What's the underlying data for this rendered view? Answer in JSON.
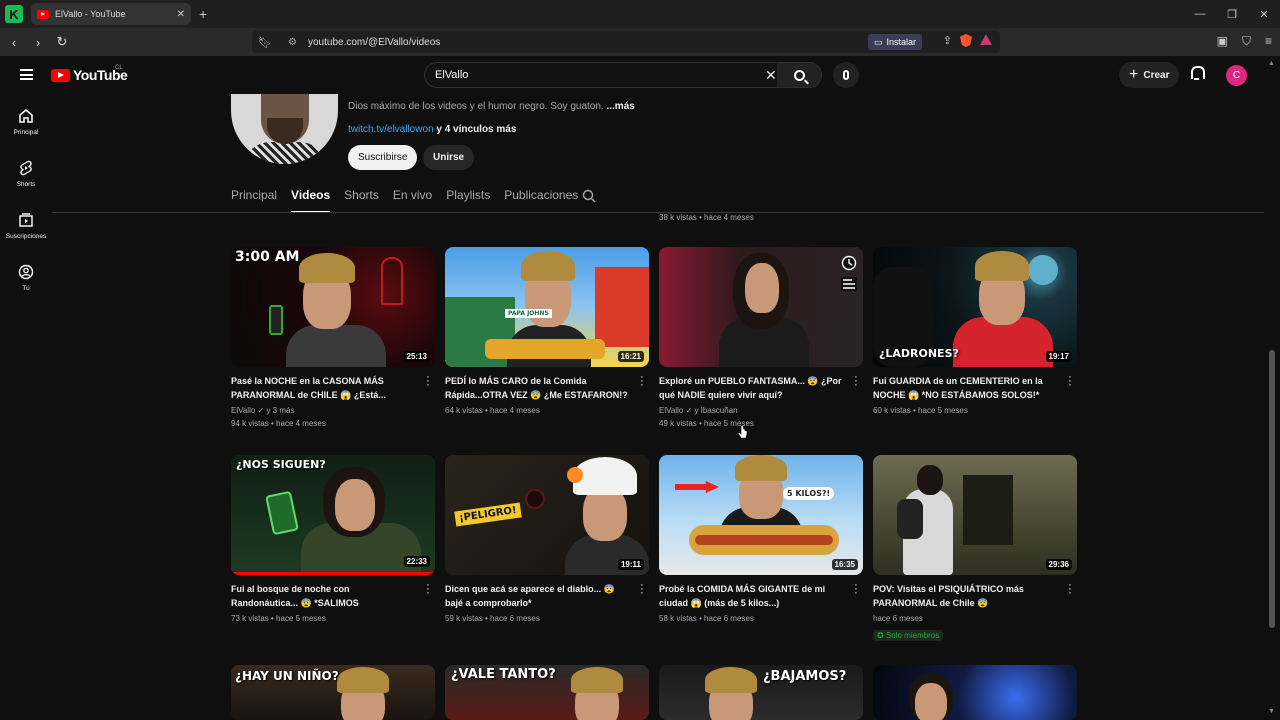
{
  "browser": {
    "tab_title": "ElVallo - YouTube",
    "url": "youtube.com/@ElVallo/videos",
    "install_label": "Instalar"
  },
  "header": {
    "logo_text": "YouTube",
    "country": "CL",
    "search_value": "ElVallo",
    "create_label": "Crear",
    "avatar_letter": "C"
  },
  "sidebar": {
    "items": [
      {
        "label": "Principal",
        "icon": "home-icon"
      },
      {
        "label": "Shorts",
        "icon": "shorts-icon"
      },
      {
        "label": "Suscripciones",
        "icon": "subscriptions-icon"
      },
      {
        "label": "Tú",
        "icon": "you-icon"
      }
    ]
  },
  "channel": {
    "description": "Dios máximo de los videos y el humor negro. Soy guaton.",
    "description_more": "...más",
    "link": "twitch.tv/elvallowon",
    "link_more": "y 4 vínculos más",
    "subscribe_label": "Suscribirse",
    "join_label": "Unirse",
    "tabs": [
      "Principal",
      "Videos",
      "Shorts",
      "En vivo",
      "Playlists",
      "Publicaciones"
    ],
    "active_tab": "Videos"
  },
  "previous_row_meta": "38 k vistas • hace 4 meses",
  "videos": [
    {
      "title": "Pasé la NOCHE en la CASONA MÁS PARANORMAL de CHILE 😱 ¿Está...",
      "author": "ElVallo ✓ y 3 más",
      "meta": "94 k vistas • hace 4 meses",
      "duration": "25:13",
      "overlay": "3:00 AM"
    },
    {
      "title": "PEDÍ lo MÁS CARO de la Comida Rápida...OTRA VEZ 😨 ¿Me ESTAFARON!?",
      "meta": "64 k vistas • hace 4 meses",
      "duration": "16:21",
      "overlay": "PAPA JOHNS"
    },
    {
      "title": "Exploré un PUEBLO FANTASMA... 😨 ¿Por qué NADIE quiere vivir aquí?",
      "author": "ElVallo ✓ y Ibascuñan",
      "meta": "49 k vistas • hace 5 meses",
      "duration": "",
      "overlay": ""
    },
    {
      "title": "Fui GUARDIA de un CEMENTERIO en la NOCHE 😱 *NO ESTÁBAMOS SOLOS!*",
      "meta": "60 k vistas • hace 5 meses",
      "duration": "19:17",
      "overlay": "¿LADRONES?"
    },
    {
      "title": "Fui al bosque de noche con Randonáutica... 😨 *SALIMOS CORRIENDO*",
      "meta": "73 k vistas • hace 5 meses",
      "duration": "22:33",
      "overlay": "¿NOS SIGUEN?"
    },
    {
      "title": "Dicen que acá se aparece el diablo... 😨 bajé a comprobarlo*",
      "meta": "59 k vistas • hace 6 meses",
      "duration": "19:11",
      "overlay": "¡PELIGRO!"
    },
    {
      "title": "Probé la COMIDA MÁS GIGANTE de mi ciudad 😱 (más de 5 kilos...)",
      "meta": "58 k vistas • hace 6 meses",
      "duration": "16:35",
      "overlay": "5 KILOS?!"
    },
    {
      "title": "POV: Visitas el PSIQUIÁTRICO más PARANORMAL de Chile 😨",
      "meta": "hace 6 meses",
      "duration": "29:36",
      "overlay": "",
      "badge": "Solo miembros"
    },
    {
      "overlay": "¿HAY UN NIÑO?"
    },
    {
      "overlay": "¿VALE TANTO?"
    },
    {
      "overlay": "¿BAJAMOS?"
    },
    {
      "overlay": ""
    }
  ]
}
